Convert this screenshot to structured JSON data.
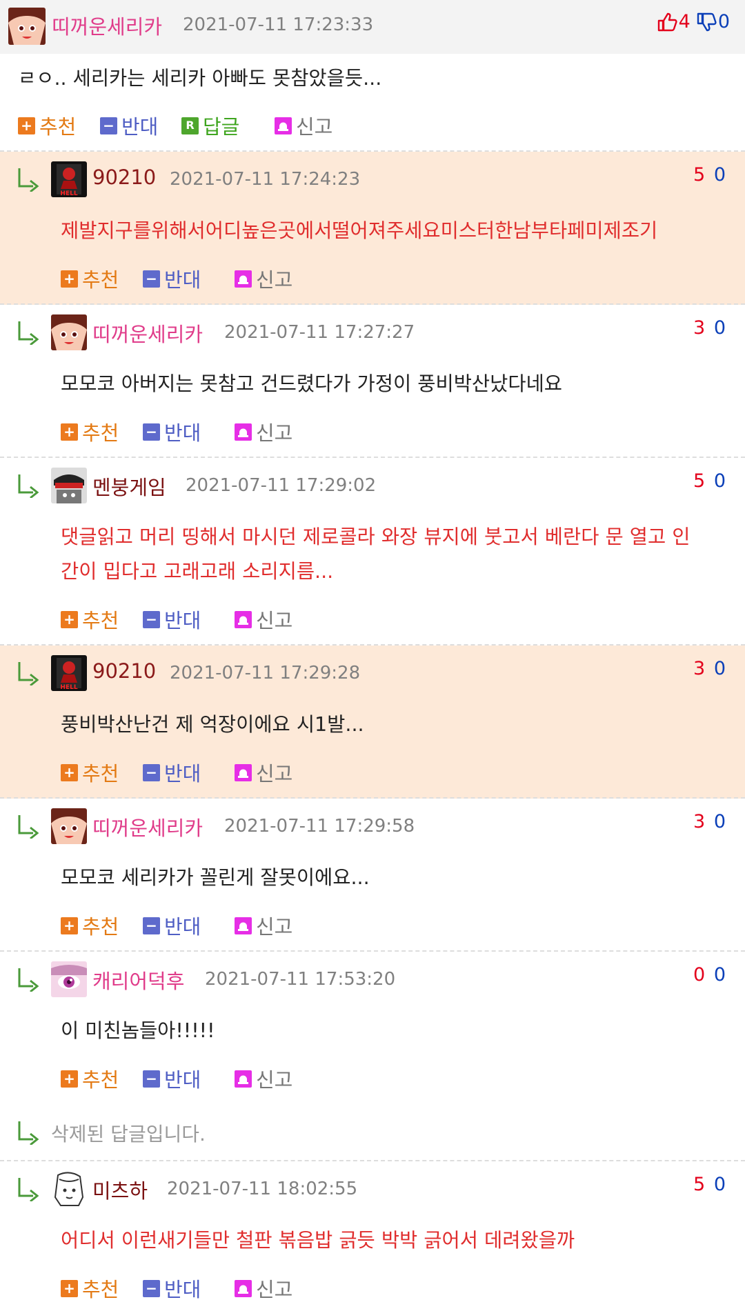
{
  "parent": {
    "nick": "띠꺼운세리카",
    "time": "2021-07-11 17:23:33",
    "up": "4",
    "down": "0",
    "body": "ㄹㅇ.. 세리카는 세리카 아빠도 못참았을듯...",
    "actions": {
      "recommend": "추천",
      "oppose": "반대",
      "reply": "답글",
      "report": "신고",
      "reply_icon": "R"
    }
  },
  "replies": [
    {
      "nick": "90210",
      "nick_color": "#8b1a1a",
      "time": "2021-07-11 17:24:23",
      "up": "5",
      "down": "0",
      "body_lines": [
        "제발지구를위해서어디높은곳에서떨어져주세요미스터한남부타페미제조기"
      ],
      "body_red": true
    },
    {
      "nick": "띠꺼운세리카",
      "nick_color": "#e03c8a",
      "time": "2021-07-11 17:27:27",
      "up": "3",
      "down": "0",
      "body_lines": [
        "모모코 아버지는 못참고 건드렸다가 가정이 풍비박산났다네요"
      ],
      "body_red": false
    },
    {
      "nick": "멘붕게임",
      "nick_color": "#7a1010",
      "time": "2021-07-11 17:29:02",
      "up": "5",
      "down": "0",
      "body_lines": [
        "댓글읽고 머리 띵해서 마시던 제로콜라 와장 뷰지에 붓고서 베란다 문 열고 인",
        "간이 밉다고 고래고래 소리지름..."
      ],
      "body_red": true
    },
    {
      "nick": "90210",
      "nick_color": "#8b1a1a",
      "time": "2021-07-11 17:29:28",
      "up": "3",
      "down": "0",
      "body_lines": [
        "풍비박산난건 제 억장이에요 시1발..."
      ],
      "body_red": false
    },
    {
      "nick": "띠꺼운세리카",
      "nick_color": "#e03c8a",
      "time": "2021-07-11 17:29:58",
      "up": "3",
      "down": "0",
      "body_lines": [
        "모모코 세리카가 꼴린게 잘못이에요..."
      ],
      "body_red": false
    },
    {
      "nick": "캐리어덕후",
      "nick_color": "#e03c8a",
      "time": "2021-07-11 17:53:20",
      "up": "0",
      "down": "0",
      "body_lines": [
        "이 미친놈들아!!!!!"
      ],
      "body_red": false
    },
    {
      "nick": "미츠하",
      "nick_color": "#7a1010",
      "time": "2021-07-11 18:02:55",
      "up": "5",
      "down": "0",
      "body_lines": [
        "어디서 이런새기들만 철판 볶음밥 긁듯 박박 긁어서 데려왔을까"
      ],
      "body_red": true
    }
  ],
  "deleted_text": "삭제된 답글입니다.",
  "reply_actions": {
    "recommend": "추천",
    "oppose": "반대",
    "report": "신고"
  },
  "colors": {
    "highlight_bg": "#fde9d8",
    "parent_bg": "#f3f3f3",
    "up": "#e3001b",
    "down": "#0b3fb8"
  }
}
